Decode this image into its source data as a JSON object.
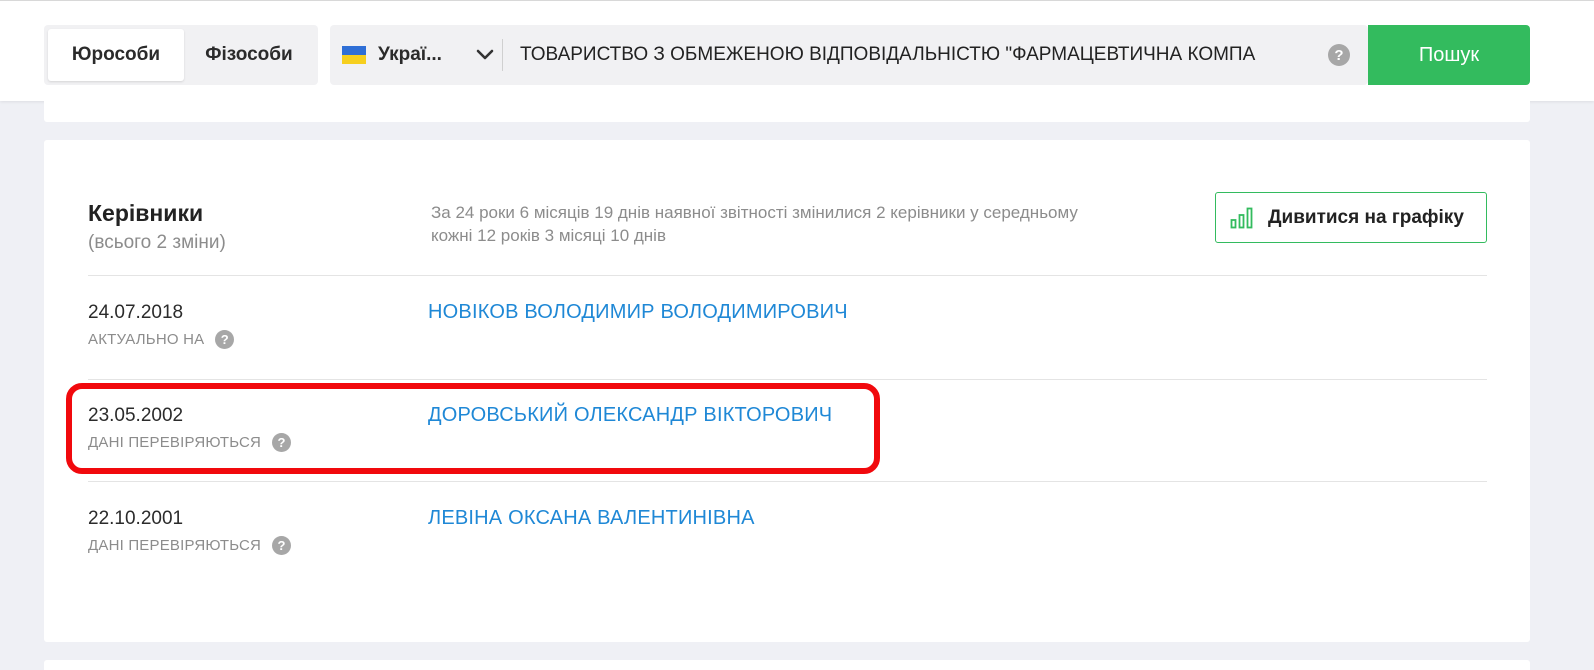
{
  "search": {
    "tabs": [
      {
        "label": "Юрособи",
        "active": true
      },
      {
        "label": "Фізособи",
        "active": false
      }
    ],
    "country": "Украї...",
    "query": "ТОВАРИСТВО З ОБМЕЖЕНОЮ ВІДПОВІДАЛЬНІСТЮ \"ФАРМАЦЕВТИЧНА КОМПА",
    "help_glyph": "?",
    "button_label": "Пошук"
  },
  "directors": {
    "title": "Керівники",
    "subtitle": "(всього 2 зміни)",
    "description": "За 24 роки 6 місяців 19 днів наявної звітності змінилися 2 керівники у середньому кожні 12 років 3 місяці 10 днів",
    "chart_button_label": "Дивитися на графіку",
    "rows": [
      {
        "date": "24.07.2018",
        "status": "АКТУАЛЬНО НА",
        "name": "НОВІКОВ ВОЛОДИМИР ВОЛОДИМИРОВИЧ"
      },
      {
        "date": "23.05.2002",
        "status": "ДАНІ ПЕРЕВІРЯЮТЬСЯ",
        "name": "ДОРОВСЬКИЙ ОЛЕКСАНДР ВІКТОРОВИЧ"
      },
      {
        "date": "22.10.2001",
        "status": "ДАНІ ПЕРЕВІРЯЮТЬСЯ",
        "name": "ЛЕВІНА ОКСАНА ВАЛЕНТИНІВНА"
      }
    ]
  },
  "colors": {
    "accent_green": "#33bb5e",
    "link_blue": "#1f88d6",
    "highlight_red": "#f1090d",
    "background": "#eff0f5"
  },
  "icons": {
    "chart_button": "bar-chart-icon",
    "country_dropdown": "chevron-down-icon",
    "flag": "ukraine-flag-icon",
    "help": "question-circle-icon"
  }
}
